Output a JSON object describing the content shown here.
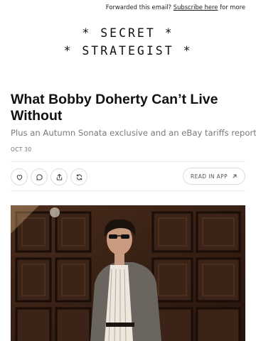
{
  "header": {
    "forwarded_text": "Forwarded this email?",
    "subscribe_link": "Subscribe here",
    "forwarded_suffix": "for more"
  },
  "logo": {
    "line1": "* SECRET *",
    "line2": "* STRATEGIST *"
  },
  "post": {
    "title": "What Bobby Doherty Can’t Live Without",
    "subtitle": "Plus an Autumn Sonata exclusive and an eBay tariffs report.",
    "date": "OCT 30"
  },
  "actions": {
    "icons": [
      "heart-icon",
      "comment-icon",
      "share-icon",
      "restack-icon"
    ],
    "read_in_app": "READ IN APP"
  },
  "colors": {
    "text": "#111111",
    "muted": "#7a7a7a",
    "border": "#dcdcdc",
    "photo_wood": "#3a2216"
  }
}
